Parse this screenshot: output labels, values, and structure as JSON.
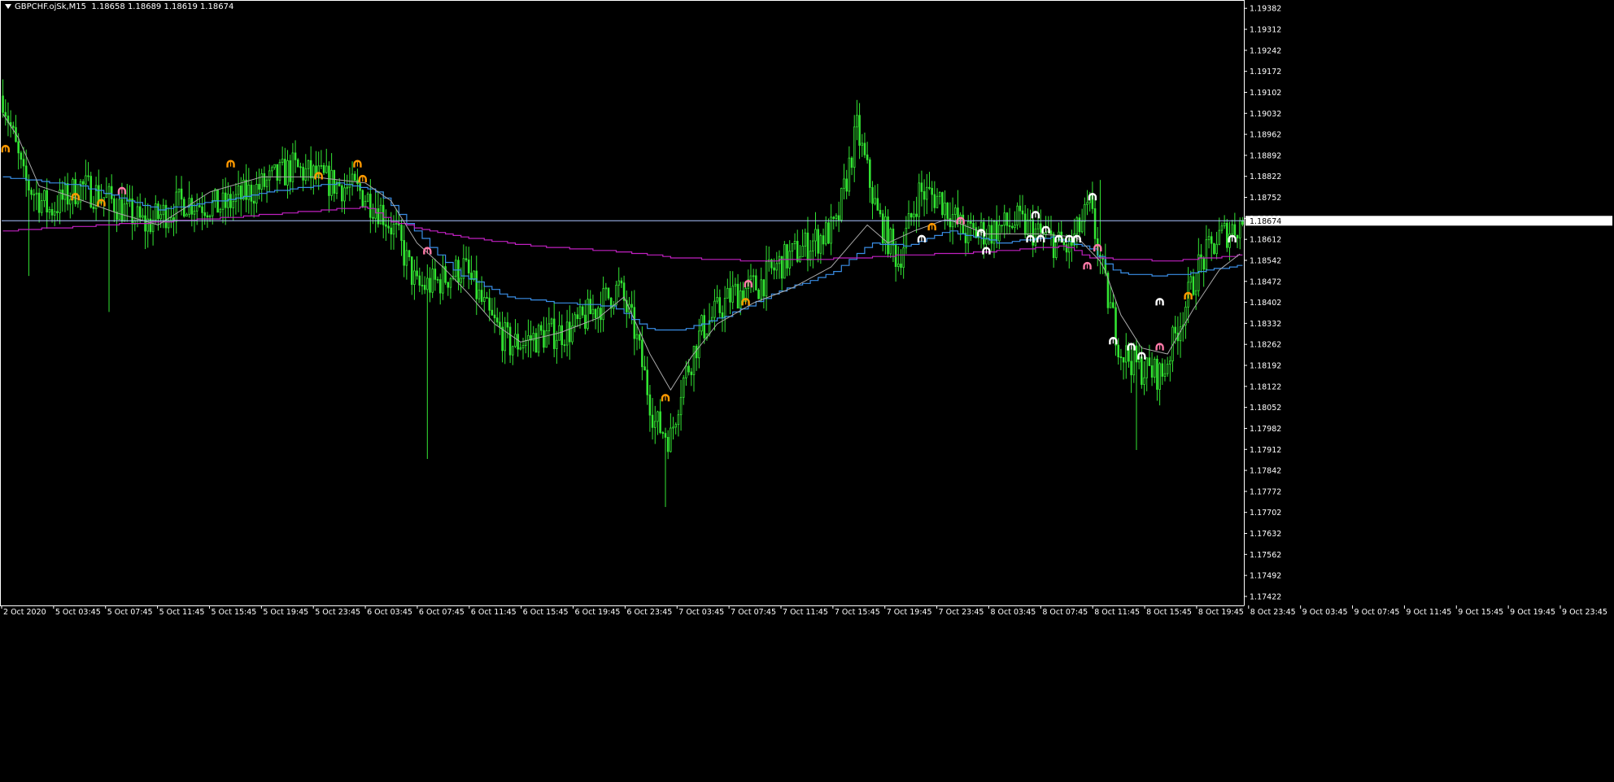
{
  "header": {
    "symbol": "GBPCHF.ojSk,M15",
    "ohlc": "1.18658 1.18689 1.18619 1.18674"
  },
  "chart_data": {
    "type": "candlestick",
    "title": "GBPCHF.ojSk,M15",
    "ylim": [
      1.17392,
      1.19407
    ],
    "y_ticks": [
      "1.19382",
      "1.19312",
      "1.19242",
      "1.19172",
      "1.19102",
      "1.19032",
      "1.18962",
      "1.18892",
      "1.18822",
      "1.18752",
      "1.18682",
      "1.18612",
      "1.18542",
      "1.18472",
      "1.18402",
      "1.18332",
      "1.18262",
      "1.18192",
      "1.18122",
      "1.18052",
      "1.17982",
      "1.17912",
      "1.17842",
      "1.17772",
      "1.17702",
      "1.17632",
      "1.17562",
      "1.17492",
      "1.17422"
    ],
    "x_ticks": [
      "2 Oct 2020",
      "5 Oct 03:45",
      "5 Oct 07:45",
      "5 Oct 11:45",
      "5 Oct 15:45",
      "5 Oct 19:45",
      "5 Oct 23:45",
      "6 Oct 03:45",
      "6 Oct 07:45",
      "6 Oct 11:45",
      "6 Oct 15:45",
      "6 Oct 19:45",
      "6 Oct 23:45",
      "7 Oct 03:45",
      "7 Oct 07:45",
      "7 Oct 11:45",
      "7 Oct 15:45",
      "7 Oct 19:45",
      "7 Oct 23:45",
      "8 Oct 03:45",
      "8 Oct 07:45",
      "8 Oct 11:45",
      "8 Oct 15:45",
      "8 Oct 19:45",
      "8 Oct 23:45",
      "9 Oct 03:45",
      "9 Oct 07:45",
      "9 Oct 11:45",
      "9 Oct 15:45",
      "9 Oct 19:45",
      "9 Oct 23:45"
    ],
    "current_price": "1.18674",
    "bar_count": 480,
    "close_path": [
      [
        0,
        1.1909
      ],
      [
        8,
        1.1881
      ],
      [
        18,
        1.1871
      ],
      [
        30,
        1.1879
      ],
      [
        42,
        1.1874
      ],
      [
        55,
        1.1866
      ],
      [
        70,
        1.1874
      ],
      [
        85,
        1.1872
      ],
      [
        100,
        1.1879
      ],
      [
        112,
        1.1885
      ],
      [
        124,
        1.1881
      ],
      [
        138,
        1.1877
      ],
      [
        146,
        1.1871
      ],
      [
        152,
        1.1863
      ],
      [
        160,
        1.1845
      ],
      [
        168,
        1.1847
      ],
      [
        178,
        1.1852
      ],
      [
        188,
        1.1835
      ],
      [
        196,
        1.1826
      ],
      [
        208,
        1.1829
      ],
      [
        220,
        1.1831
      ],
      [
        230,
        1.1839
      ],
      [
        238,
        1.1845
      ],
      [
        244,
        1.1831
      ],
      [
        252,
        1.18
      ],
      [
        258,
        1.1795
      ],
      [
        262,
        1.1812
      ],
      [
        270,
        1.1831
      ],
      [
        282,
        1.1843
      ],
      [
        292,
        1.1846
      ],
      [
        300,
        1.1853
      ],
      [
        312,
        1.186
      ],
      [
        322,
        1.1865
      ],
      [
        330,
        1.1898
      ],
      [
        338,
        1.1869
      ],
      [
        346,
        1.1854
      ],
      [
        354,
        1.1877
      ],
      [
        362,
        1.1875
      ],
      [
        372,
        1.1863
      ],
      [
        382,
        1.1864
      ],
      [
        392,
        1.1867
      ],
      [
        402,
        1.1862
      ],
      [
        412,
        1.1858
      ],
      [
        420,
        1.1872
      ],
      [
        426,
        1.1845
      ],
      [
        432,
        1.1824
      ],
      [
        440,
        1.1818
      ],
      [
        448,
        1.1816
      ],
      [
        454,
        1.1832
      ],
      [
        462,
        1.1852
      ],
      [
        470,
        1.1862
      ],
      [
        479,
        1.1867
      ]
    ],
    "spike_bars": [
      {
        "i": 164,
        "low": 1.1788
      },
      {
        "i": 256,
        "low": 1.1772
      },
      {
        "i": 331,
        "high": 1.1897
      },
      {
        "i": 424,
        "high": 1.1881
      },
      {
        "i": 438,
        "low": 1.1791
      },
      {
        "i": 10,
        "low": 1.1849
      },
      {
        "i": 41,
        "low": 1.1837
      }
    ],
    "series": [
      {
        "name": "",
        "style": "step",
        "color": "#3a8ee6",
        "points": [
          [
            0,
            1.1882
          ],
          [
            30,
            1.1879
          ],
          [
            60,
            1.1871
          ],
          [
            90,
            1.1875
          ],
          [
            110,
            1.1878
          ],
          [
            130,
            1.188
          ],
          [
            145,
            1.1877
          ],
          [
            160,
            1.1863
          ],
          [
            175,
            1.185
          ],
          [
            195,
            1.1842
          ],
          [
            215,
            1.184
          ],
          [
            235,
            1.1839
          ],
          [
            250,
            1.1831
          ],
          [
            262,
            1.1831
          ],
          [
            280,
            1.1836
          ],
          [
            300,
            1.1844
          ],
          [
            320,
            1.185
          ],
          [
            335,
            1.186
          ],
          [
            350,
            1.1859
          ],
          [
            365,
            1.1864
          ],
          [
            385,
            1.186
          ],
          [
            405,
            1.1862
          ],
          [
            420,
            1.1858
          ],
          [
            430,
            1.185
          ],
          [
            445,
            1.1849
          ],
          [
            460,
            1.185
          ],
          [
            479,
            1.1853
          ]
        ]
      },
      {
        "name": "",
        "style": "step",
        "color": "#c020c0",
        "points": [
          [
            0,
            1.1864
          ],
          [
            40,
            1.1866
          ],
          [
            80,
            1.1868
          ],
          [
            110,
            1.187
          ],
          [
            140,
            1.1872
          ],
          [
            150,
            1.1867
          ],
          [
            170,
            1.1863
          ],
          [
            185,
            1.1861
          ],
          [
            205,
            1.1859
          ],
          [
            240,
            1.1857
          ],
          [
            260,
            1.1855
          ],
          [
            290,
            1.1854
          ],
          [
            330,
            1.1855
          ],
          [
            350,
            1.1856
          ],
          [
            380,
            1.1857
          ],
          [
            410,
            1.1859
          ],
          [
            420,
            1.1855
          ],
          [
            450,
            1.1854
          ],
          [
            479,
            1.1856
          ]
        ]
      },
      {
        "name": "",
        "style": "line",
        "color": "#a8a8a8",
        "points": [
          [
            0,
            1.1903
          ],
          [
            6,
            1.1895
          ],
          [
            14,
            1.1879
          ],
          [
            28,
            1.1875
          ],
          [
            44,
            1.187
          ],
          [
            60,
            1.1866
          ],
          [
            80,
            1.1877
          ],
          [
            100,
            1.1882
          ],
          [
            120,
            1.1882
          ],
          [
            140,
            1.188
          ],
          [
            150,
            1.1874
          ],
          [
            160,
            1.186
          ],
          [
            170,
            1.1852
          ],
          [
            180,
            1.1843
          ],
          [
            190,
            1.1833
          ],
          [
            200,
            1.1827
          ],
          [
            215,
            1.183
          ],
          [
            230,
            1.1835
          ],
          [
            240,
            1.1842
          ],
          [
            250,
            1.1823
          ],
          [
            258,
            1.1811
          ],
          [
            266,
            1.1822
          ],
          [
            276,
            1.1833
          ],
          [
            290,
            1.184
          ],
          [
            305,
            1.1845
          ],
          [
            320,
            1.1852
          ],
          [
            334,
            1.1866
          ],
          [
            342,
            1.186
          ],
          [
            352,
            1.1864
          ],
          [
            365,
            1.1868
          ],
          [
            380,
            1.1863
          ],
          [
            400,
            1.1863
          ],
          [
            415,
            1.1862
          ],
          [
            425,
            1.1853
          ],
          [
            432,
            1.1836
          ],
          [
            440,
            1.1825
          ],
          [
            450,
            1.1823
          ],
          [
            460,
            1.1838
          ],
          [
            470,
            1.1851
          ],
          [
            479,
            1.1857
          ]
        ]
      }
    ],
    "horizontal_line": {
      "price": 1.18674,
      "color": "#aac4ff"
    },
    "markers": [
      {
        "i": 1,
        "price": 1.1891,
        "color": "#ff9900"
      },
      {
        "i": 28,
        "price": 1.1875,
        "color": "#ff9900"
      },
      {
        "i": 38,
        "price": 1.1873,
        "color": "#ff9900"
      },
      {
        "i": 46,
        "price": 1.1877,
        "color": "#ff7aa8"
      },
      {
        "i": 88,
        "price": 1.1886,
        "color": "#ff9900"
      },
      {
        "i": 122,
        "price": 1.1882,
        "color": "#ff9900"
      },
      {
        "i": 137,
        "price": 1.1886,
        "color": "#ff9900"
      },
      {
        "i": 139,
        "price": 1.1881,
        "color": "#ff9900"
      },
      {
        "i": 164,
        "price": 1.1857,
        "color": "#ff7aa8"
      },
      {
        "i": 256,
        "price": 1.1808,
        "color": "#ff9900"
      },
      {
        "i": 288,
        "price": 1.1846,
        "color": "#ff7aa8"
      },
      {
        "i": 287,
        "price": 1.184,
        "color": "#ff9900"
      },
      {
        "i": 355,
        "price": 1.1861,
        "color": "#ffffff"
      },
      {
        "i": 359,
        "price": 1.1865,
        "color": "#ff9900"
      },
      {
        "i": 370,
        "price": 1.1867,
        "color": "#ff7aa8"
      },
      {
        "i": 378,
        "price": 1.1863,
        "color": "#ffffff"
      },
      {
        "i": 380,
        "price": 1.1857,
        "color": "#ffffff"
      },
      {
        "i": 397,
        "price": 1.1861,
        "color": "#ffffff"
      },
      {
        "i": 399,
        "price": 1.1869,
        "color": "#ffffff"
      },
      {
        "i": 401,
        "price": 1.1861,
        "color": "#ffffff"
      },
      {
        "i": 403,
        "price": 1.1864,
        "color": "#ffffff"
      },
      {
        "i": 408,
        "price": 1.1861,
        "color": "#ffffff"
      },
      {
        "i": 412,
        "price": 1.1861,
        "color": "#ffffff"
      },
      {
        "i": 415,
        "price": 1.1861,
        "color": "#ffffff"
      },
      {
        "i": 421,
        "price": 1.1875,
        "color": "#ffffff"
      },
      {
        "i": 423,
        "price": 1.1858,
        "color": "#ff7aa8"
      },
      {
        "i": 419,
        "price": 1.1852,
        "color": "#ff7aa8"
      },
      {
        "i": 429,
        "price": 1.1827,
        "color": "#ffffff"
      },
      {
        "i": 436,
        "price": 1.1825,
        "color": "#ffffff"
      },
      {
        "i": 440,
        "price": 1.1822,
        "color": "#ffffff"
      },
      {
        "i": 447,
        "price": 1.1825,
        "color": "#ff7aa8"
      },
      {
        "i": 447,
        "price": 1.184,
        "color": "#ffffff"
      },
      {
        "i": 458,
        "price": 1.1842,
        "color": "#ff9900"
      },
      {
        "i": 475,
        "price": 1.1861,
        "color": "#ffffff"
      }
    ],
    "colors": {
      "background": "#000000",
      "candle": "#33e633",
      "axis": "#ffffff",
      "text": "#ffffff"
    }
  }
}
